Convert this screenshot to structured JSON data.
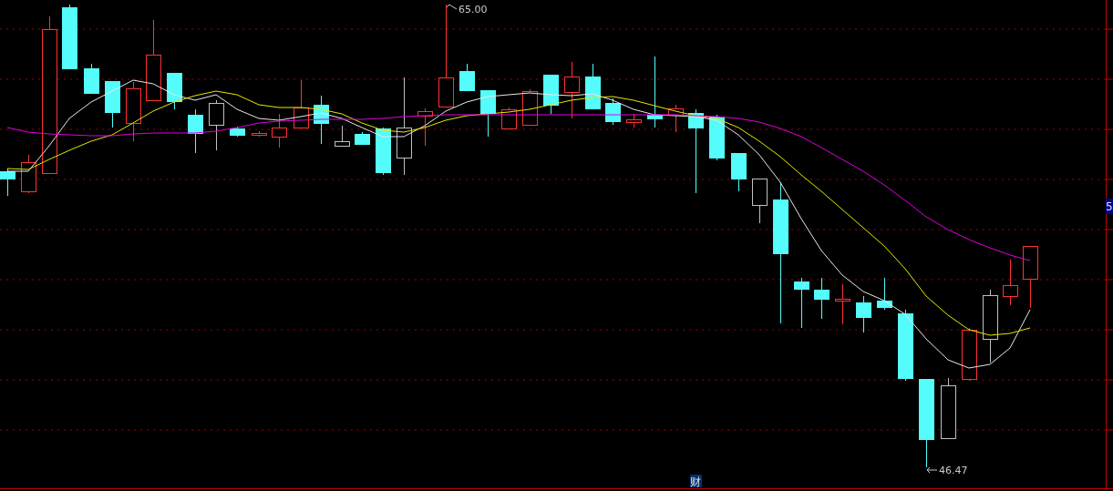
{
  "chart": {
    "high_label": "65.00",
    "low_label": "46.47",
    "axis_label": "5",
    "bottom_marker": "财"
  }
}
